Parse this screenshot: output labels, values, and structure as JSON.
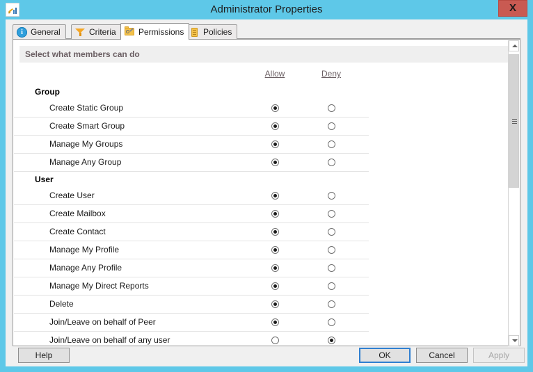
{
  "window": {
    "title": "Administrator Properties",
    "app_icon": "report-chart-icon",
    "close_label": "X",
    "titlebar_color": "#5ec8e8",
    "close_color": "#c95a52"
  },
  "tabs": [
    {
      "label": "General",
      "icon": "info-icon",
      "active": false
    },
    {
      "label": "Criteria",
      "icon": "funnel-icon",
      "active": false
    },
    {
      "label": "Permissions",
      "icon": "folder-key-icon",
      "active": true
    },
    {
      "label": "Policies",
      "icon": "book-icon",
      "active": false
    }
  ],
  "page": {
    "band_title": "Select what members can do",
    "columns": {
      "allow": "Allow",
      "deny": "Deny"
    },
    "groups": [
      {
        "title": "Group",
        "rows": [
          {
            "label": "Create Static Group",
            "value": "allow"
          },
          {
            "label": "Create Smart Group",
            "value": "allow"
          },
          {
            "label": "Manage My Groups",
            "value": "allow"
          },
          {
            "label": "Manage Any Group",
            "value": "allow"
          }
        ]
      },
      {
        "title": "User",
        "rows": [
          {
            "label": "Create User",
            "value": "allow"
          },
          {
            "label": "Create Mailbox",
            "value": "allow"
          },
          {
            "label": "Create Contact",
            "value": "allow"
          },
          {
            "label": "Manage My Profile",
            "value": "allow"
          },
          {
            "label": "Manage Any Profile",
            "value": "allow"
          },
          {
            "label": "Manage My Direct Reports",
            "value": "allow"
          },
          {
            "label": "Delete",
            "value": "allow"
          },
          {
            "label": "Join/Leave on behalf of Peer",
            "value": "allow"
          },
          {
            "label": "Join/Leave on behalf of any user",
            "value": "deny"
          }
        ]
      }
    ]
  },
  "scrollbar": {
    "up_icon": "chevron-up-icon",
    "down_icon": "chevron-down-icon",
    "thumb_top_pct": 1,
    "thumb_height_pct": 47
  },
  "footer": {
    "help": "Help",
    "ok": "OK",
    "cancel": "Cancel",
    "apply": "Apply",
    "apply_disabled": true,
    "ok_focus_color": "#2f7fd0"
  }
}
